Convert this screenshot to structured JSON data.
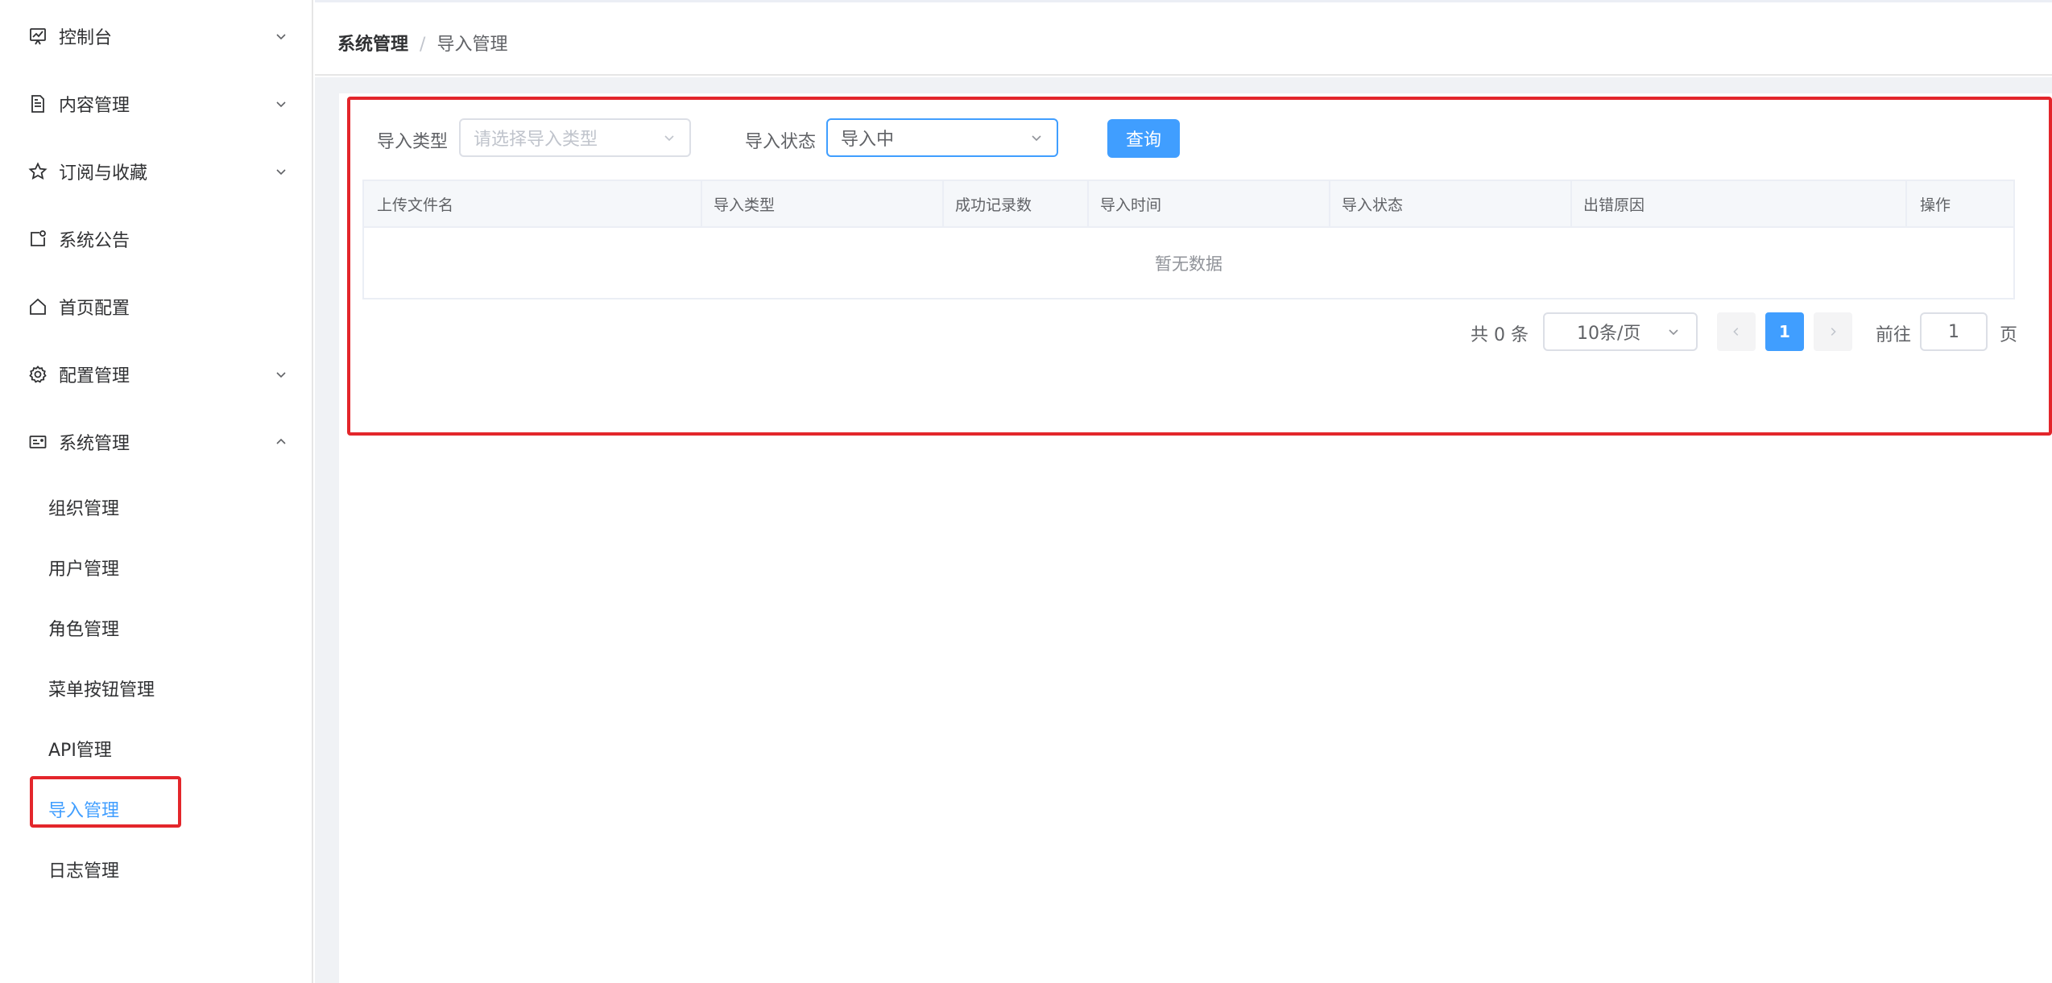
{
  "sidebar": {
    "items": [
      {
        "label": "控制台",
        "icon": "dashboard-icon",
        "expandable": true
      },
      {
        "label": "内容管理",
        "icon": "document-icon",
        "expandable": true
      },
      {
        "label": "订阅与收藏",
        "icon": "star-icon",
        "expandable": true
      },
      {
        "label": "系统公告",
        "icon": "notice-icon",
        "expandable": false
      },
      {
        "label": "首页配置",
        "icon": "home-icon",
        "expandable": false
      },
      {
        "label": "配置管理",
        "icon": "gear-icon",
        "expandable": true
      },
      {
        "label": "系统管理",
        "icon": "system-card-icon",
        "expandable": true,
        "expanded": true
      }
    ],
    "sub_items": [
      {
        "label": "组织管理"
      },
      {
        "label": "用户管理"
      },
      {
        "label": "角色管理"
      },
      {
        "label": "菜单按钮管理"
      },
      {
        "label": "API管理"
      },
      {
        "label": "导入管理",
        "active": true
      },
      {
        "label": "日志管理"
      }
    ]
  },
  "breadcrumb": {
    "parent": "系统管理",
    "separator": "/",
    "current": "导入管理"
  },
  "filters": {
    "type_label": "导入类型",
    "type_placeholder": "请选择导入类型",
    "status_label": "导入状态",
    "status_value": "导入中",
    "query_button": "查询"
  },
  "table": {
    "columns": [
      "上传文件名",
      "导入类型",
      "成功记录数",
      "导入时间",
      "导入状态",
      "出错原因",
      "操作"
    ],
    "rows": [],
    "empty_text": "暂无数据"
  },
  "pagination": {
    "total_text": "共 0 条",
    "page_size": "10条/页",
    "current_page": "1",
    "goto_label": "前往",
    "goto_value": "1",
    "page_suffix": "页"
  },
  "colors": {
    "accent": "#409eff",
    "highlight": "#e3262b"
  }
}
